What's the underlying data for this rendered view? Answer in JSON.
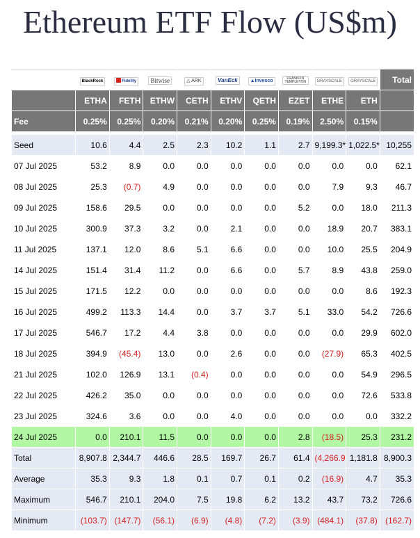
{
  "title": "Ethereum ETF Flow (US$m)",
  "logos": [
    {
      "name": "blackrock-logo",
      "text": "BlackRock"
    },
    {
      "name": "fidelity-logo",
      "text": "Fidelity"
    },
    {
      "name": "bitwise-logo",
      "text": "Bitwise"
    },
    {
      "name": "ark-logo",
      "text": "ARK"
    },
    {
      "name": "vaneck-logo",
      "text": "VanEck"
    },
    {
      "name": "invesco-logo",
      "text": "Invesco"
    },
    {
      "name": "franklin-logo",
      "text": "FRANKLIN TEMPLETON"
    },
    {
      "name": "grayscale-logo",
      "text": "GRAYSCALE"
    },
    {
      "name": "grayscale-mini-logo",
      "text": "GRAYSCALE"
    }
  ],
  "total_header": "Total",
  "tickers": [
    "ETHA",
    "FETH",
    "ETHW",
    "CETH",
    "ETHV",
    "QETH",
    "EZET",
    "ETHE",
    "ETH"
  ],
  "fee": {
    "label": "Fee",
    "values": [
      "0.25%",
      "0.25%",
      "0.20%",
      "0.21%",
      "0.20%",
      "0.25%",
      "0.19%",
      "2.50%",
      "0.15%"
    ]
  },
  "rows": [
    {
      "label": "Seed",
      "values": [
        "10.6",
        "4.4",
        "2.5",
        "2.3",
        "10.2",
        "1.1",
        "2.7",
        "9,199.3*",
        "1,022.5*",
        "10,255"
      ],
      "style": "seed"
    },
    {
      "label": "07 Jul 2025",
      "values": [
        "53.2",
        "8.9",
        "0.0",
        "0.0",
        "0.0",
        "0.0",
        "0.0",
        "0.0",
        "0.0",
        "62.1"
      ]
    },
    {
      "label": "08 Jul 2025",
      "values": [
        "25.3",
        "(0.7)",
        "4.9",
        "0.0",
        "0.0",
        "0.0",
        "0.0",
        "7.9",
        "9.3",
        "46.7"
      ]
    },
    {
      "label": "09 Jul 2025",
      "values": [
        "158.6",
        "29.5",
        "0.0",
        "0.0",
        "0.0",
        "0.0",
        "5.2",
        "0.0",
        "18.0",
        "211.3"
      ]
    },
    {
      "label": "10 Jul 2025",
      "values": [
        "300.9",
        "37.3",
        "3.2",
        "0.0",
        "2.1",
        "0.0",
        "0.0",
        "18.9",
        "20.7",
        "383.1"
      ]
    },
    {
      "label": "11 Jul 2025",
      "values": [
        "137.1",
        "12.0",
        "8.6",
        "5.1",
        "6.6",
        "0.0",
        "0.0",
        "10.0",
        "25.5",
        "204.9"
      ]
    },
    {
      "label": "14 Jul 2025",
      "values": [
        "151.4",
        "31.4",
        "11.2",
        "0.0",
        "6.6",
        "0.0",
        "5.7",
        "8.9",
        "43.8",
        "259.0"
      ]
    },
    {
      "label": "15 Jul 2025",
      "values": [
        "171.5",
        "12.2",
        "0.0",
        "0.0",
        "0.0",
        "0.0",
        "0.0",
        "0.0",
        "8.6",
        "192.3"
      ]
    },
    {
      "label": "16 Jul 2025",
      "values": [
        "499.2",
        "113.3",
        "14.4",
        "0.0",
        "3.7",
        "3.7",
        "5.1",
        "33.0",
        "54.2",
        "726.6"
      ]
    },
    {
      "label": "17 Jul 2025",
      "values": [
        "546.7",
        "17.2",
        "4.4",
        "3.8",
        "0.0",
        "0.0",
        "0.0",
        "0.0",
        "29.9",
        "602.0"
      ]
    },
    {
      "label": "18 Jul 2025",
      "values": [
        "394.9",
        "(45.4)",
        "13.0",
        "0.0",
        "2.6",
        "0.0",
        "0.0",
        "(27.9)",
        "65.3",
        "402.5"
      ]
    },
    {
      "label": "21 Jul 2025",
      "values": [
        "102.0",
        "126.9",
        "13.1",
        "(0.4)",
        "0.0",
        "0.0",
        "0.0",
        "0.0",
        "54.9",
        "296.5"
      ]
    },
    {
      "label": "22 Jul 2025",
      "values": [
        "426.2",
        "35.0",
        "0.0",
        "0.0",
        "0.0",
        "0.0",
        "0.0",
        "0.0",
        "72.6",
        "533.8"
      ]
    },
    {
      "label": "23 Jul 2025",
      "values": [
        "324.6",
        "3.6",
        "0.0",
        "0.0",
        "4.0",
        "0.0",
        "0.0",
        "0.0",
        "0.0",
        "332.2"
      ]
    },
    {
      "label": "24 Jul 2025",
      "values": [
        "0.0",
        "210.1",
        "11.5",
        "0.0",
        "0.0",
        "0.0",
        "2.8",
        "(18.5)",
        "25.3",
        "231.2"
      ],
      "style": "hl"
    },
    {
      "label": "Total",
      "values": [
        "8,907.8",
        "2,344.7",
        "446.6",
        "28.5",
        "169.7",
        "26.7",
        "61.4",
        "(4,266.9)",
        "1,181.8",
        "8,900.3"
      ],
      "style": "sum"
    },
    {
      "label": "Average",
      "values": [
        "35.3",
        "9.3",
        "1.8",
        "0.1",
        "0.7",
        "0.1",
        "0.2",
        "(16.9)",
        "4.7",
        "35.3"
      ],
      "style": "sum"
    },
    {
      "label": "Maximum",
      "values": [
        "546.7",
        "210.1",
        "204.0",
        "7.5",
        "19.8",
        "6.2",
        "13.2",
        "43.7",
        "73.2",
        "726.6"
      ],
      "style": "sum"
    },
    {
      "label": "Minimum",
      "values": [
        "(103.7)",
        "(147.7)",
        "(56.1)",
        "(6.9)",
        "(4.8)",
        "(7.2)",
        "(3.9)",
        "(484.1)",
        "(37.8)",
        "(162.7)"
      ],
      "style": "sum"
    }
  ],
  "colors": {
    "header_bg": "#777777",
    "seed_bg": "#e4e9f4",
    "highlight_bg": "#b1f7a4",
    "negative": "#d41f1f"
  }
}
